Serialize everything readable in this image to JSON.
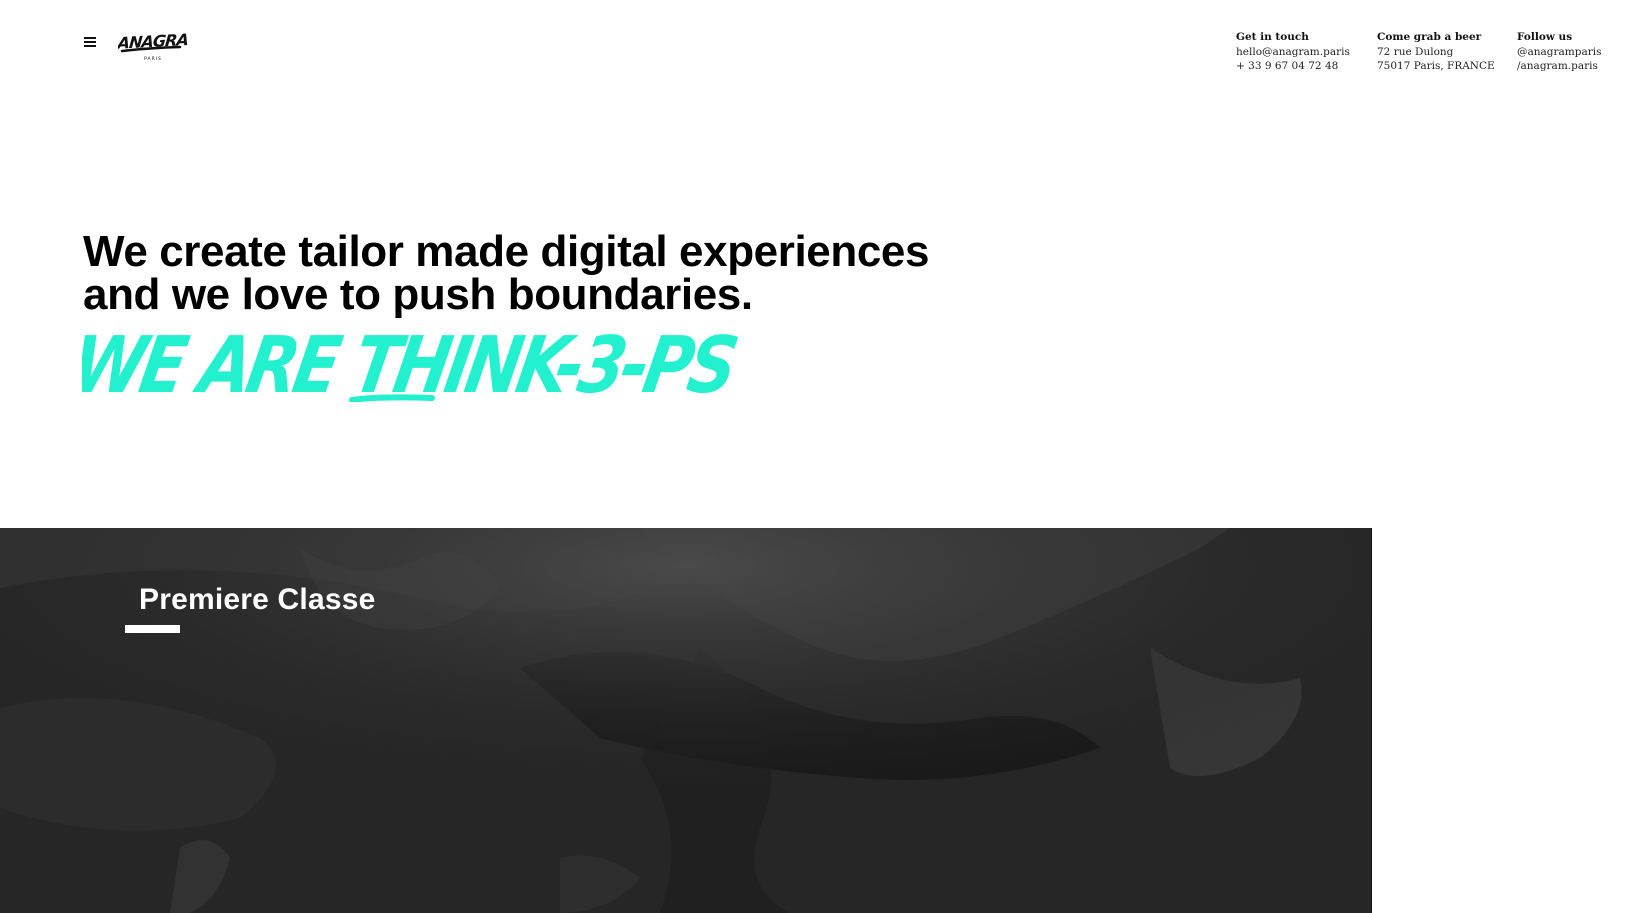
{
  "brand": {
    "logo_text": "ANAGRAM",
    "logo_subtext": "PARIS"
  },
  "contact": {
    "get_in_touch": {
      "heading": "Get in touch",
      "email": "hello@anagram.paris",
      "phone": "+ 33 9 67 04 72 48"
    },
    "grab_a_beer": {
      "heading": "Come grab a beer",
      "street": "72 rue Dulong",
      "city": "75017 Paris, FRANCE"
    },
    "follow_us": {
      "heading": "Follow us",
      "handle_1": "@anagramparis",
      "handle_2": "/anagram.paris"
    }
  },
  "hero": {
    "line_1": "We create tailor made digital experiences",
    "line_2": "and we love to push boundaries.",
    "tagline": "WE ARE THINK-3-PS",
    "tagline_color": "#23f0cf"
  },
  "project": {
    "title": "Premiere Classe",
    "background": "#262626"
  },
  "icons": {
    "menu": "hamburger-menu-icon"
  }
}
